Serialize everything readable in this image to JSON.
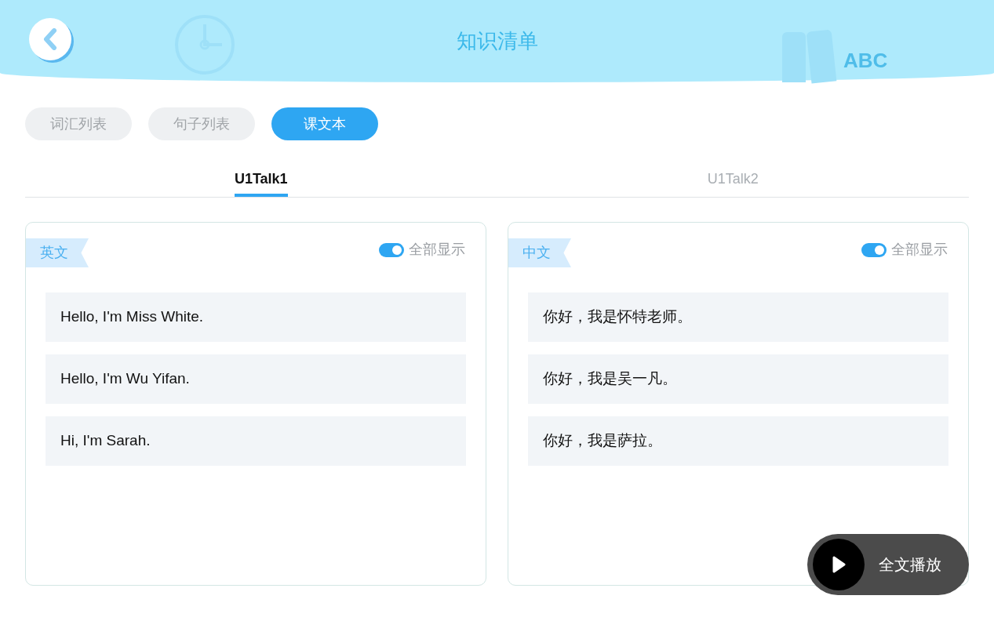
{
  "header": {
    "title": "知识清单",
    "decoration_text": "ABC"
  },
  "tabs": [
    {
      "label": "词汇列表",
      "selected": false
    },
    {
      "label": "句子列表",
      "selected": false
    },
    {
      "label": "课文本",
      "selected": true
    }
  ],
  "lessons": [
    {
      "label": "U1Talk1",
      "selected": true
    },
    {
      "label": "U1Talk2",
      "selected": false
    }
  ],
  "panels": [
    {
      "tag": "英文",
      "toggle": {
        "label": "全部显示",
        "on": true
      },
      "lines": [
        "Hello, I'm Miss White.",
        "Hello, I'm Wu Yifan.",
        "Hi, I'm Sarah."
      ]
    },
    {
      "tag": "中文",
      "toggle": {
        "label": "全部显示",
        "on": true
      },
      "lines": [
        "你好，我是怀特老师。",
        "你好，我是吴一凡。",
        "你好，我是萨拉。"
      ]
    }
  ],
  "play_button": {
    "label": "全文播放"
  }
}
